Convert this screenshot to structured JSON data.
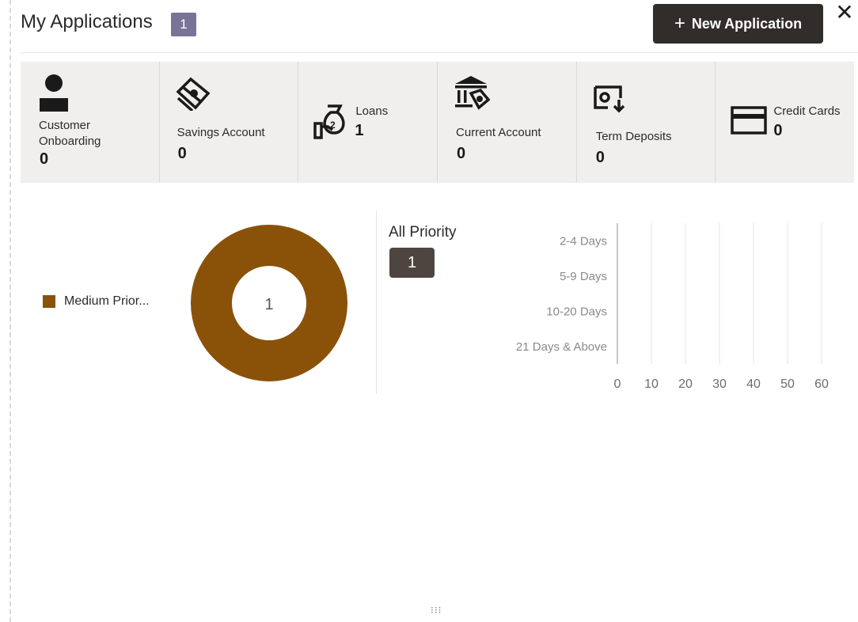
{
  "header": {
    "title": "My Applications",
    "count": "1",
    "new_button_label": "New Application",
    "close_symbol": "✕"
  },
  "tiles": [
    {
      "label": "Customer\nOnboarding",
      "value": "0",
      "icon": "person-icon"
    },
    {
      "label": "Savings Account",
      "value": "0",
      "icon": "money-stack-icon"
    },
    {
      "label": "Loans",
      "value": "1",
      "icon": "money-bag-hand-icon"
    },
    {
      "label": "Current Account",
      "value": "0",
      "icon": "bank-money-icon"
    },
    {
      "label": "Term Deposits",
      "value": "0",
      "icon": "deposit-clock-icon"
    },
    {
      "label": "Credit Cards",
      "value": "0",
      "icon": "credit-card-icon"
    }
  ],
  "priority_panel": {
    "title": "All Priority",
    "count": "1"
  },
  "colors": {
    "accent": "#8a5209",
    "button": "#312d2a",
    "badge": "#7a7398",
    "tile_bg": "#f1efed"
  },
  "chart_data": [
    {
      "type": "pie",
      "series": [
        {
          "name": "Medium Prior...",
          "values": [
            1
          ]
        }
      ],
      "categories": [
        "Medium Prior..."
      ],
      "center_label": "1",
      "legend": "left"
    },
    {
      "type": "bar",
      "orientation": "horizontal",
      "categories": [
        "2-4 Days",
        "5-9 Days",
        "10-20 Days",
        "21 Days & Above"
      ],
      "values": [
        0,
        0,
        0,
        0
      ],
      "xticks": [
        "0",
        "10",
        "20",
        "30",
        "40",
        "50",
        "60"
      ],
      "xlim": [
        0,
        60
      ],
      "grid": true
    }
  ]
}
